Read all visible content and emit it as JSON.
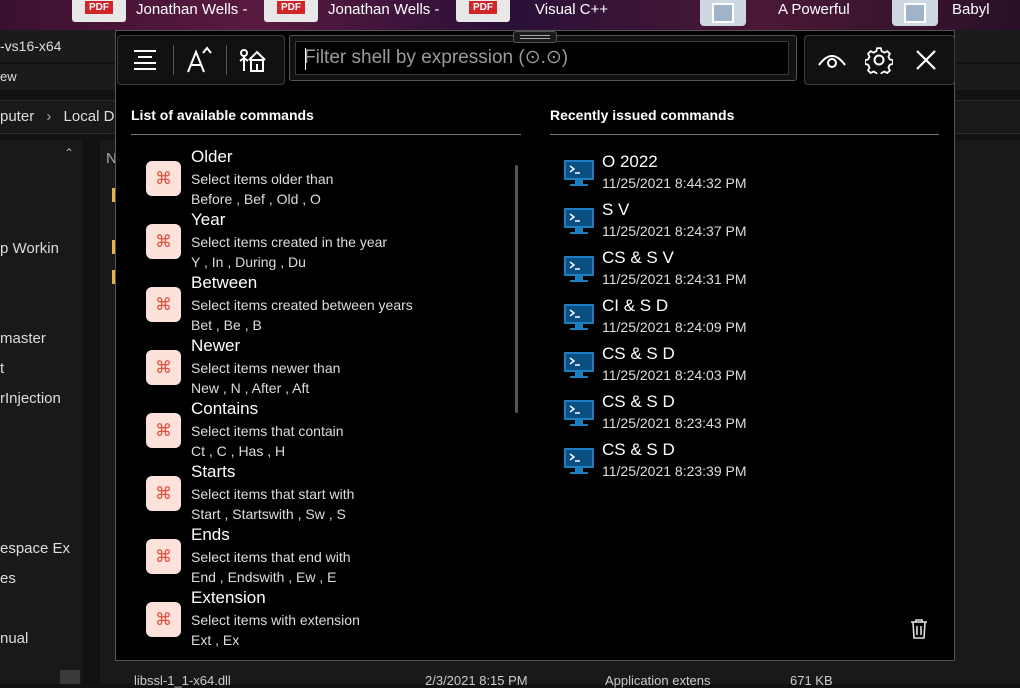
{
  "taskbar": {
    "thumbs": [
      {
        "badge": "PDF",
        "label": "Jonathan Wells -"
      },
      {
        "badge": "PDF",
        "label": "Jonathan Wells -"
      },
      {
        "badge": "PDF",
        "label": "Visual C++"
      },
      {
        "badge": "",
        "label": "A Powerful"
      },
      {
        "badge": "",
        "label": "Babyl"
      }
    ]
  },
  "explorer": {
    "title": "-vs16-x64",
    "menu_item": "ew",
    "breadcrumb": [
      "puter",
      "Local Dis"
    ],
    "column_header": "N",
    "sidebar_items": [
      "p Workin",
      "master",
      "t",
      "rInjection",
      "espace Ex",
      "es",
      "nual"
    ],
    "file_row": {
      "name": "libssl-1_1-x64.dll",
      "date": "2/3/2021 8:15 PM",
      "type": "Application extens",
      "size": "671 KB"
    }
  },
  "shell": {
    "filter": {
      "placeholder": "Filter shell by expression (⊙.⊙)",
      "value": ""
    },
    "toolbar": {
      "left_icons": [
        "menu-lines-icon",
        "font-size-icon",
        "home-people-icon"
      ],
      "right_icons": [
        "eye-icon",
        "gear-icon",
        "close-icon"
      ]
    },
    "commands_title": "List of available commands",
    "recent_title": "Recently issued commands",
    "commands": [
      {
        "name": "Older",
        "desc": "Select items older than",
        "aliases": "Before , Bef , Old , O"
      },
      {
        "name": "Year",
        "desc": "Select items created in the year",
        "aliases": "Y , In , During , Du"
      },
      {
        "name": "Between",
        "desc": "Select items created between years",
        "aliases": "Bet , Be , B"
      },
      {
        "name": "Newer",
        "desc": "Select items newer than",
        "aliases": "New , N , After , Aft"
      },
      {
        "name": "Contains",
        "desc": "Select items that contain",
        "aliases": "Ct , C , Has , H"
      },
      {
        "name": "Starts",
        "desc": "Select items that start with",
        "aliases": "Start , Startswith , Sw , S"
      },
      {
        "name": "Ends",
        "desc": "Select items that end with",
        "aliases": "End , Endswith , Ew , E"
      },
      {
        "name": "Extension",
        "desc": "Select items with extension",
        "aliases": "Ext , Ex"
      }
    ],
    "recent": [
      {
        "name": "O 2022",
        "time": "11/25/2021 8:44:32 PM"
      },
      {
        "name": "S V",
        "time": "11/25/2021 8:24:37 PM"
      },
      {
        "name": "CS & S V",
        "time": "11/25/2021 8:24:31 PM"
      },
      {
        "name": "CI & S D",
        "time": "11/25/2021 8:24:09 PM"
      },
      {
        "name": "CS & S D",
        "time": "11/25/2021 8:24:03 PM"
      },
      {
        "name": "CS & S D",
        "time": "11/25/2021 8:23:43 PM"
      },
      {
        "name": "CS & S D",
        "time": "11/25/2021 8:23:39 PM"
      }
    ],
    "colors": {
      "accent_icon_bg": "#fde2dc",
      "accent_icon_fg": "#e0503a",
      "terminal_blue": "#1e7fc0"
    }
  }
}
